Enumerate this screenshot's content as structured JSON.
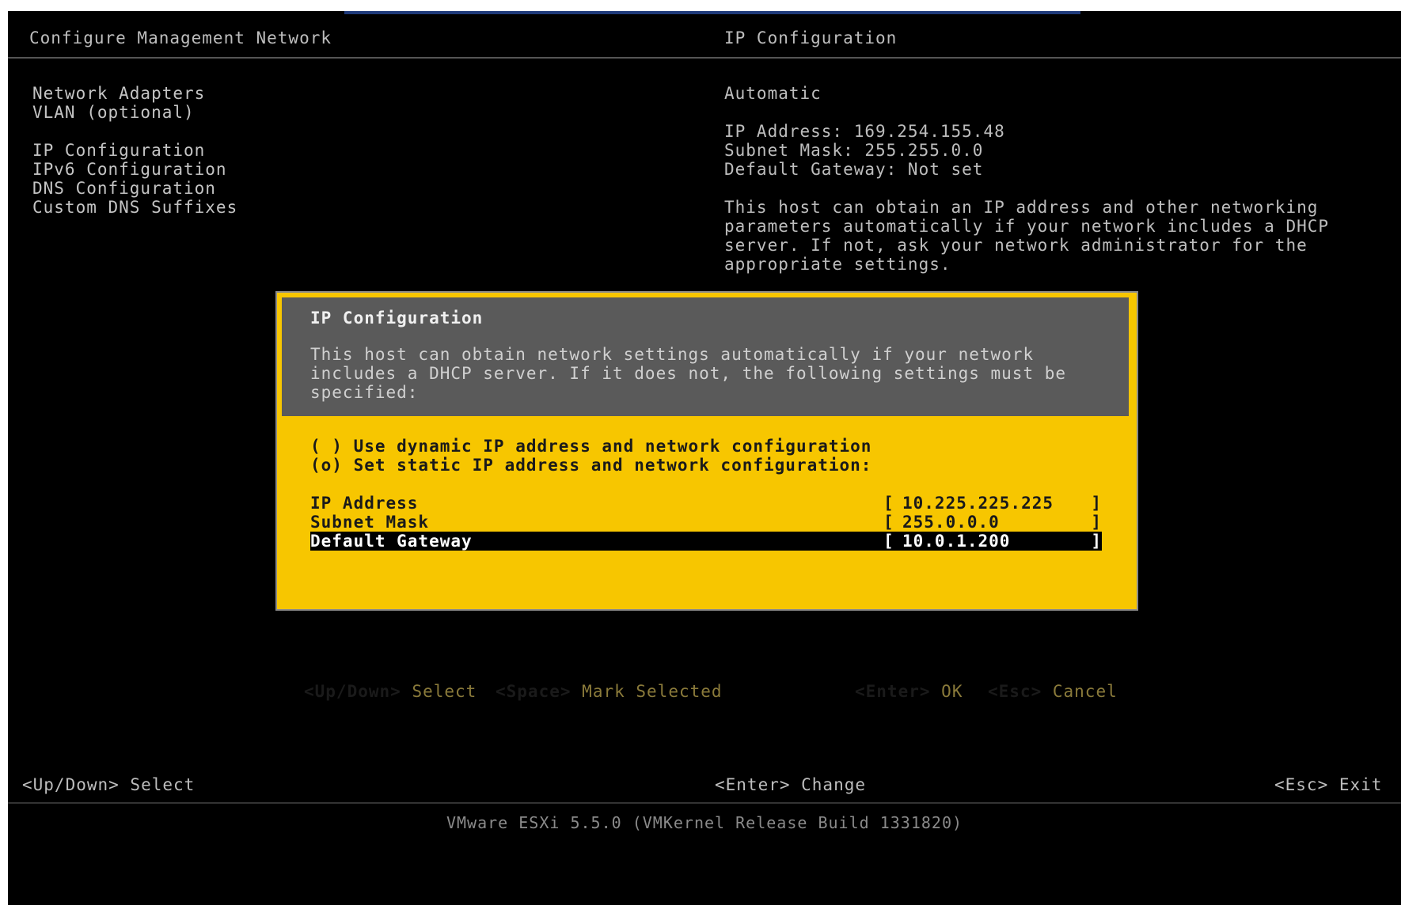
{
  "header": {
    "left_title": "Configure Management Network",
    "right_title": "IP Configuration"
  },
  "menu": {
    "items": [
      {
        "label": "Network Adapters"
      },
      {
        "label": "VLAN (optional)"
      },
      {
        "label": "IP Configuration"
      },
      {
        "label": "IPv6 Configuration"
      },
      {
        "label": "DNS Configuration"
      },
      {
        "label": "Custom DNS Suffixes"
      }
    ]
  },
  "info": {
    "mode": "Automatic",
    "ip_line": "IP Address: 169.254.155.48",
    "subnet_line": "Subnet Mask: 255.255.0.0",
    "gateway_line": "Default Gateway: Not set",
    "description": "This host can obtain an IP address and other networking\nparameters automatically if your network includes a DHCP\nserver. If not, ask your network administrator for the\nappropriate settings."
  },
  "dialog": {
    "title": "IP Configuration",
    "description": "This host can obtain network settings automatically if your network\nincludes a DHCP server. If it does not, the following settings must be\nspecified:",
    "option_dynamic": "( ) Use dynamic IP address and network configuration",
    "option_static": "(o) Set static IP address and network configuration:",
    "fields": [
      {
        "label": "IP Address",
        "value": "10.225.225.225"
      },
      {
        "label": "Subnet Mask",
        "value": "255.0.0.0"
      },
      {
        "label": "Default Gateway",
        "value": "10.0.1.200"
      }
    ],
    "keys": {
      "updown_key": "<Up/Down>",
      "updown_action": "Select",
      "space_key": "<Space>",
      "space_action": "Mark Selected",
      "enter_key": "<Enter>",
      "enter_action": "OK",
      "esc_key": "<Esc>",
      "esc_action": "Cancel"
    }
  },
  "bottom": {
    "left": "<Up/Down> Select",
    "middle": "<Enter> Change",
    "right": "<Esc> Exit"
  },
  "footer": "VMware ESXi 5.5.0 (VMKernel Release Build 1331820)",
  "colors": {
    "background": "#000000",
    "dialog_accent": "#f7c600",
    "dialog_header": "#5a5a5a",
    "selected_row": "#000000"
  }
}
